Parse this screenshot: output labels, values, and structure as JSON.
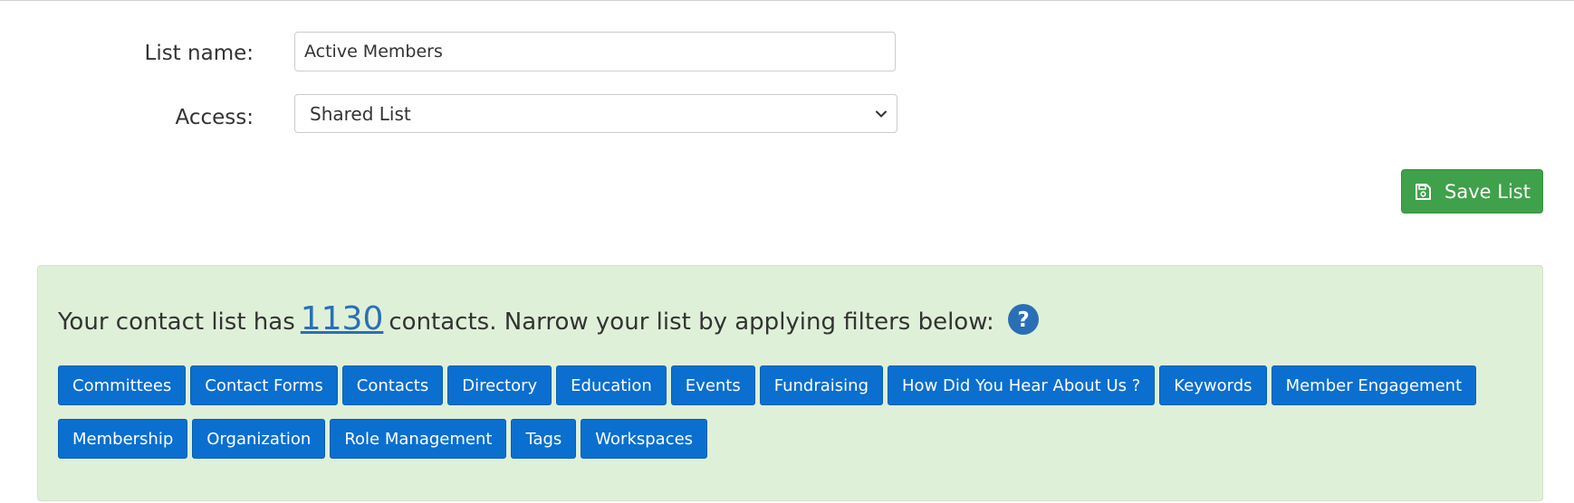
{
  "form": {
    "list_name_label": "List name:",
    "list_name_value": "Active Members",
    "access_label": "Access:",
    "access_value": "Shared List"
  },
  "actions": {
    "save_label": "Save List",
    "save_icon": "floppy-disk-icon",
    "save_color": "#3fa14a"
  },
  "filters": {
    "summary_prefix": "Your contact list has",
    "contact_count": "1130",
    "summary_suffix": "contacts. Narrow your list by applying filters below:",
    "help_icon": "question-circle-icon",
    "panel_color": "#dff0d8",
    "chip_color": "#0a6fcf",
    "row1": [
      "Committees",
      "Contact Forms",
      "Contacts",
      "Directory",
      "Education",
      "Events",
      "Fundraising",
      "How Did You Hear About Us ?",
      "Keywords",
      "Member Engagement"
    ],
    "row2": [
      "Membership",
      "Organization",
      "Role Management",
      "Tags",
      "Workspaces"
    ]
  }
}
